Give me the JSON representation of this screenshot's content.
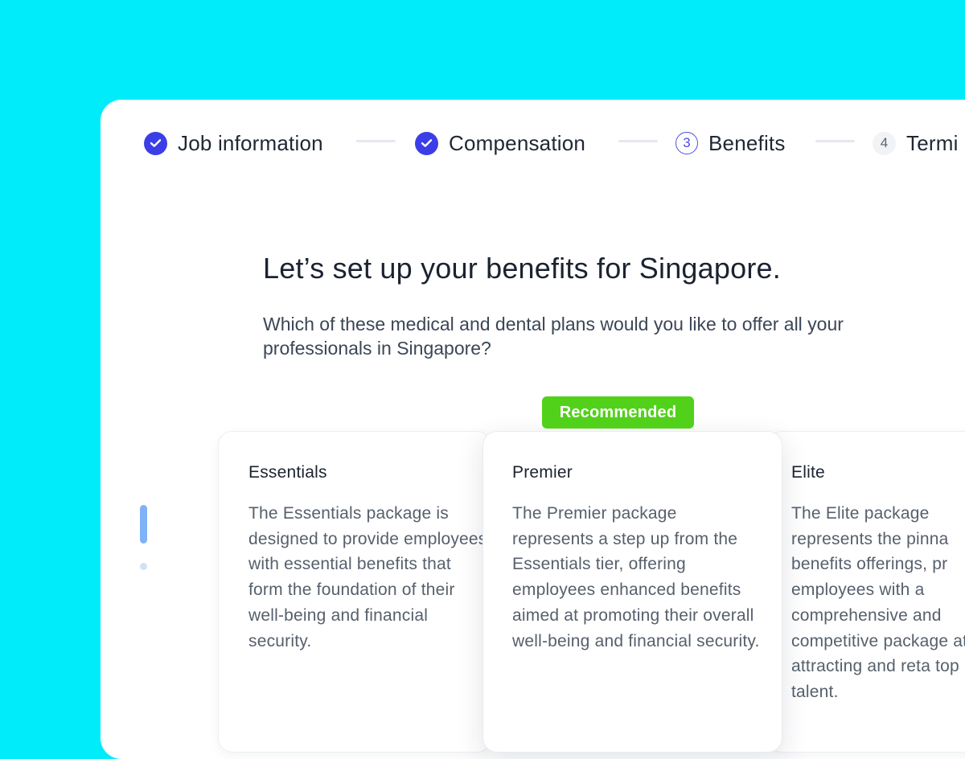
{
  "stepper": {
    "steps": [
      {
        "label": "Job information",
        "state": "complete",
        "icon": "check-icon"
      },
      {
        "label": "Compensation",
        "state": "complete",
        "icon": "check-icon"
      },
      {
        "label": "Benefits",
        "state": "current",
        "number": "3"
      },
      {
        "label": "Termi",
        "state": "upcoming",
        "number": "4"
      }
    ]
  },
  "main": {
    "title": "Let’s set up your benefits for Singapore.",
    "subtitle": "Which of these medical and dental plans would you like to offer all your professionals in Singapore?"
  },
  "plans": [
    {
      "name": "Essentials",
      "description": "The Essentials package is designed to provide employees with essential benefits that form the foundation of their well-being and financial security."
    },
    {
      "name": "Premier",
      "badge": "Recommended",
      "description": "The Premier package represents a step up from the Essentials tier, offering employees enhanced benefits aimed at promoting their overall well-being and financial security."
    },
    {
      "name": "Elite",
      "description": "The Elite package represents the pinna benefits offerings, pr employees with a comprehensive and competitive package at attracting and reta top talent."
    }
  ],
  "colors": {
    "background": "#00ecfb",
    "accent": "#3b3ee6",
    "badge": "#52d11b",
    "scroll_indicator": "#7fb2f7"
  }
}
